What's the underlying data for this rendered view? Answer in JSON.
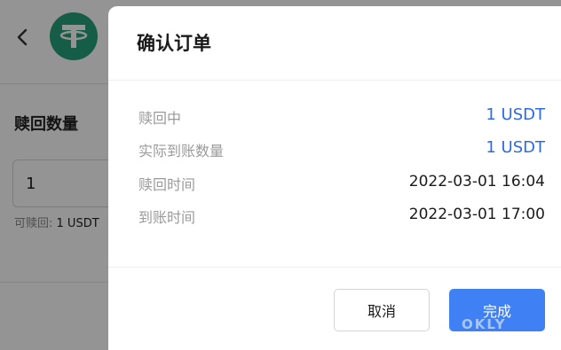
{
  "background_page": {
    "back_icon": "chevron-left-icon",
    "token_icon": "tether-logo-icon",
    "token_logo_color": "#26a17b",
    "section_title": "赎回数量",
    "input_value": "1",
    "available_label": "可赎回:",
    "available_amount": "1 USDT"
  },
  "dialog": {
    "title": "确认订单",
    "rows": [
      {
        "label": "赎回中",
        "value": "1 USDT"
      },
      {
        "label": "实际到账数量",
        "value": "1 USDT"
      },
      {
        "label": "赎回时间",
        "value": "2022-03-01 16:04"
      },
      {
        "label": "到账时间",
        "value": "2022-03-01 17:00"
      }
    ],
    "cancel_label": "取消",
    "confirm_label": "完成"
  },
  "watermark": "OKLY",
  "colors": {
    "accent": "#2d6ae3",
    "primary_button": "#3f80f5"
  }
}
